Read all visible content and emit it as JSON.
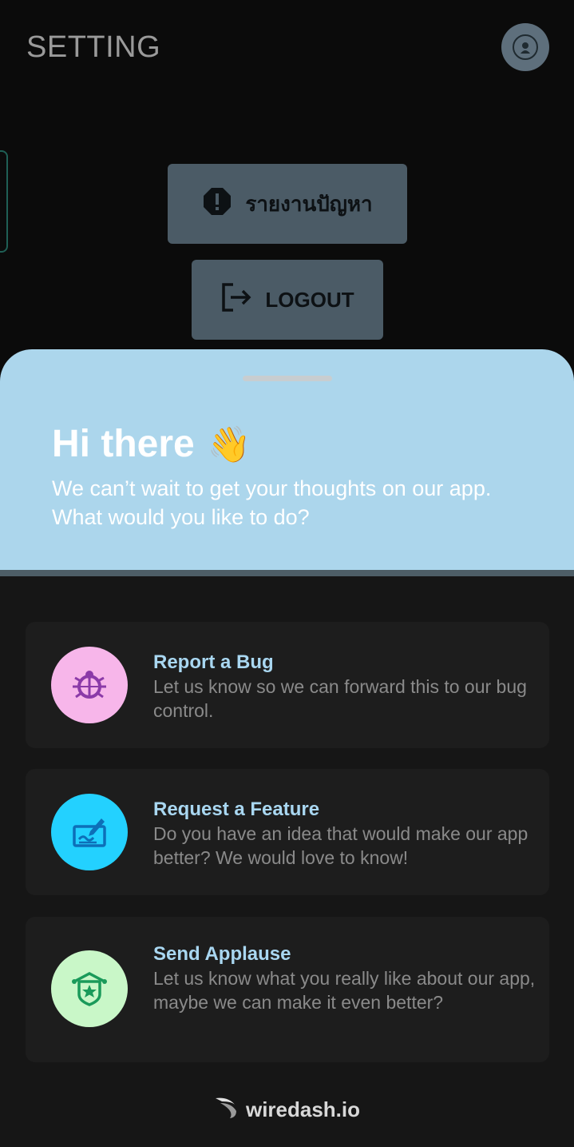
{
  "header": {
    "title": "SETTING"
  },
  "settings": {
    "report_label": "รายงานปัญหา",
    "logout_label": "LOGOUT"
  },
  "sheet": {
    "title": "Hi there",
    "wave_emoji": "👋",
    "subtitle": "We can’t wait to get your thoughts on our app. What would you like to do?"
  },
  "options": [
    {
      "title": "Report a Bug",
      "description": "Let us know so we can forward this to our bug control.",
      "icon": "bug-icon",
      "icon_bg": "#f7b6ea",
      "icon_color": "#8b3aa8"
    },
    {
      "title": "Request a Feature",
      "description": "Do you have an idea that would make our app better? We would love to know!",
      "icon": "feature-idea-icon",
      "icon_bg": "#23d1ff",
      "icon_color": "#0d6fb8"
    },
    {
      "title": "Send Applause",
      "description": "Let us know what you really like about our app, maybe we can make it even better?",
      "icon": "applause-badge-icon",
      "icon_bg": "#c9f7c8",
      "icon_color": "#1a9a5a"
    }
  ],
  "footer": {
    "brand": "wiredash.io"
  },
  "colors": {
    "sheet_header": "#acd6ec",
    "card_title": "#a9d7f1",
    "button_bg": "#4b5b66"
  }
}
